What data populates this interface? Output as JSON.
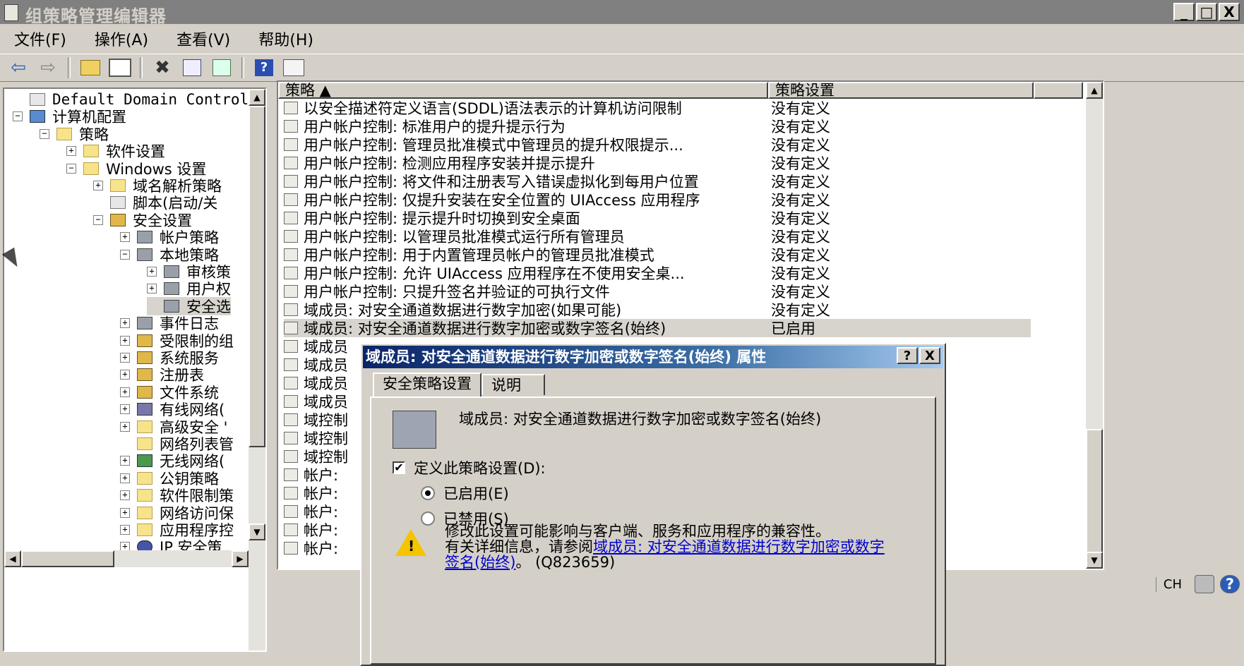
{
  "window": {
    "title": "组策略管理编辑器",
    "min_label": "_",
    "max_label": "□",
    "close_label": "X"
  },
  "menu": [
    "文件(F)",
    "操作(A)",
    "查看(V)",
    "帮助(H)"
  ],
  "toolbar": {
    "icons": [
      "back-icon",
      "forward-icon",
      "up-folder-icon",
      "show-hide-tree-icon",
      "delete-icon",
      "properties-icon",
      "export-icon",
      "help-icon",
      "console-icon"
    ]
  },
  "tree": {
    "items": [
      {
        "label": "Default Domain Controller",
        "level": 0,
        "icon": "doc",
        "exp": ""
      },
      {
        "label": "计算机配置",
        "level": 0,
        "icon": "computer",
        "exp": "⊟"
      },
      {
        "label": "策略",
        "level": 1,
        "icon": "folder",
        "exp": "⊟"
      },
      {
        "label": "软件设置",
        "level": 2,
        "icon": "folder",
        "exp": "⊞"
      },
      {
        "label": "Windows 设置",
        "level": 2,
        "icon": "folder",
        "exp": "⊟"
      },
      {
        "label": "域名解析策略",
        "level": 3,
        "icon": "folder",
        "exp": "⊞"
      },
      {
        "label": "脚本(启动/关",
        "level": 3,
        "icon": "doc",
        "exp": ""
      },
      {
        "label": "安全设置",
        "level": 3,
        "icon": "shield",
        "exp": "⊟"
      },
      {
        "label": "帐户策略",
        "level": 4,
        "icon": "policy",
        "exp": "⊞"
      },
      {
        "label": "本地策略",
        "level": 4,
        "icon": "policy",
        "exp": "⊟"
      },
      {
        "label": "审核策",
        "level": 5,
        "icon": "policy",
        "exp": "⊞"
      },
      {
        "label": "用户权",
        "level": 5,
        "icon": "policy",
        "exp": "⊞"
      },
      {
        "label": "安全选",
        "level": 5,
        "icon": "policy",
        "exp": "",
        "selected": true
      },
      {
        "label": "事件日志",
        "level": 4,
        "icon": "policy",
        "exp": "⊞"
      },
      {
        "label": "受限制的组",
        "level": 4,
        "icon": "shield",
        "exp": "⊞"
      },
      {
        "label": "系统服务",
        "level": 4,
        "icon": "shield",
        "exp": "⊞"
      },
      {
        "label": "注册表",
        "level": 4,
        "icon": "shield",
        "exp": "⊞"
      },
      {
        "label": "文件系统",
        "level": 4,
        "icon": "shield",
        "exp": "⊞"
      },
      {
        "label": "有线网络(",
        "level": 4,
        "icon": "net",
        "exp": "⊞"
      },
      {
        "label": "高级安全 '",
        "level": 4,
        "icon": "folder",
        "exp": "⊞"
      },
      {
        "label": "网络列表管",
        "level": 4,
        "icon": "folder",
        "exp": ""
      },
      {
        "label": "无线网络(",
        "level": 4,
        "icon": "wireless",
        "exp": "⊞"
      },
      {
        "label": "公钥策略",
        "level": 4,
        "icon": "folder",
        "exp": "⊞"
      },
      {
        "label": "软件限制策",
        "level": 4,
        "icon": "folder",
        "exp": "⊞"
      },
      {
        "label": "网络访问保",
        "level": 4,
        "icon": "folder",
        "exp": "⊞"
      },
      {
        "label": "应用程序控",
        "level": 4,
        "icon": "folder",
        "exp": "⊞"
      },
      {
        "label": "IP 安全策",
        "level": 4,
        "icon": "ip",
        "exp": "⊞"
      }
    ]
  },
  "list": {
    "columns": [
      "策略 ▲",
      "策略设置"
    ],
    "rows": [
      {
        "name": "以安全描述符定义语言(SDDL)语法表示的计算机访问限制",
        "setting": "没有定义"
      },
      {
        "name": "用户帐户控制: 标准用户的提升提示行为",
        "setting": "没有定义"
      },
      {
        "name": "用户帐户控制: 管理员批准模式中管理员的提升权限提示...",
        "setting": "没有定义"
      },
      {
        "name": "用户帐户控制: 检测应用程序安装并提示提升",
        "setting": "没有定义"
      },
      {
        "name": "用户帐户控制: 将文件和注册表写入错误虚拟化到每用户位置",
        "setting": "没有定义"
      },
      {
        "name": "用户帐户控制: 仅提升安装在安全位置的 UIAccess 应用程序",
        "setting": "没有定义"
      },
      {
        "name": "用户帐户控制: 提示提升时切换到安全桌面",
        "setting": "没有定义"
      },
      {
        "name": "用户帐户控制: 以管理员批准模式运行所有管理员",
        "setting": "没有定义"
      },
      {
        "name": "用户帐户控制: 用于内置管理员帐户的管理员批准模式",
        "setting": "没有定义"
      },
      {
        "name": "用户帐户控制: 允许 UIAccess 应用程序在不使用安全桌...",
        "setting": "没有定义"
      },
      {
        "name": "用户帐户控制: 只提升签名并验证的可执行文件",
        "setting": "没有定义"
      },
      {
        "name": "域成员: 对安全通道数据进行数字加密(如果可能)",
        "setting": "没有定义"
      },
      {
        "name": "域成员: 对安全通道数据进行数字加密或数字签名(始终)",
        "setting": "已启用",
        "selected": true
      },
      {
        "name": "域成员",
        "setting": ""
      },
      {
        "name": "域成员",
        "setting": ""
      },
      {
        "name": "域成员",
        "setting": ""
      },
      {
        "name": "域成员",
        "setting": ""
      },
      {
        "name": "域控制",
        "setting": ""
      },
      {
        "name": "域控制",
        "setting": ""
      },
      {
        "name": "域控制",
        "setting": ""
      },
      {
        "name": "帐户:",
        "setting": ""
      },
      {
        "name": "帐户:",
        "setting": ""
      },
      {
        "name": "帐户:",
        "setting": ""
      },
      {
        "name": "帐户:",
        "setting": ""
      },
      {
        "name": "帐户:",
        "setting": ""
      }
    ]
  },
  "dialog": {
    "title": "域成员: 对安全通道数据进行数字加密或数字签名(始终) 属性",
    "help_btn": "?",
    "close_btn": "X",
    "tabs": [
      "安全策略设置",
      "说明"
    ],
    "policy_name": "域成员: 对安全通道数据进行数字加密或数字签名(始终)",
    "define_label": "定义此策略设置(D):",
    "define_checked": true,
    "enabled_label": "已启用(E)",
    "disabled_label": "已禁用(S)",
    "selected_option": "enabled",
    "warning_line1": "修改此设置可能影响与客户端、服务和应用程序的兼容性。",
    "warning_line2_prefix": "有关详细信息，请参阅",
    "warning_link": "域成员: 对安全通道数据进行数字加密或数字签名(始终)",
    "warning_suffix": "。 (Q823659)"
  },
  "tray": {
    "lang": "CH"
  }
}
